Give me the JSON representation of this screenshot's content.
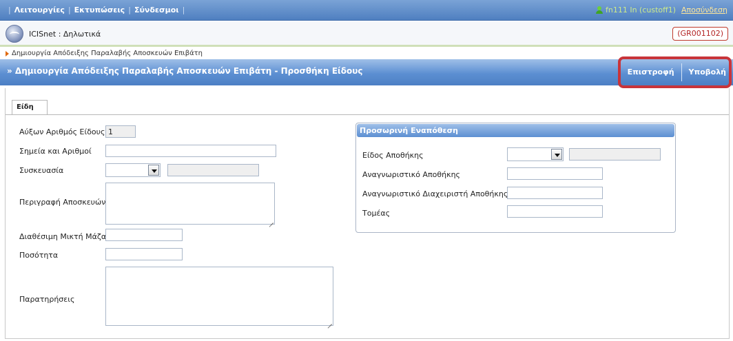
{
  "menu": {
    "items": [
      "Λειτουργίες",
      "Εκτυπώσεις",
      "Σύνδεσμοι"
    ],
    "user_text": "fn111 In (custoff1)",
    "logout_label": "Αποσύνδεση"
  },
  "app": {
    "title": "ICISnet : Δηλωτικά",
    "customs_code": "(GR001102)"
  },
  "breadcrumb": {
    "text": "Δημιουργία Απόδειξης Παραλαβής Αποσκευών Επιβάτη"
  },
  "page": {
    "title": "» Δημιουργία Απόδειξης Παραλαβής Αποσκευών Επιβάτη - Προσθήκη Είδους",
    "actions": {
      "back_label": "Επιστροφή",
      "submit_label": "Υποβολή"
    }
  },
  "tabs": {
    "items_label": "Είδη"
  },
  "form": {
    "item_number": {
      "label": "Αύξων Αριθμός Είδους",
      "value": "1"
    },
    "marks_numbers": {
      "label": "Σημεία και Αριθμοί",
      "value": ""
    },
    "packaging": {
      "label": "Συσκευασία",
      "selected": "",
      "description": ""
    },
    "baggage_description": {
      "label": "Περιγραφή Αποσκευών",
      "value": ""
    },
    "gross_mass": {
      "label": "Διαθέσιμη Μικτή Μάζα",
      "value": ""
    },
    "quantity": {
      "label": "Ποσότητα",
      "value": ""
    },
    "remarks": {
      "label": "Παρατηρήσεις",
      "value": ""
    }
  },
  "temporary_storage": {
    "title": "Προσωρινή Εναπόθεση",
    "storage_type": {
      "label": "Είδος Αποθήκης",
      "selected": "",
      "description": ""
    },
    "storage_id": {
      "label": "Αναγνωριστικό Αποθήκης",
      "value": ""
    },
    "storage_manager_id": {
      "label": "Αναγνωριστικό Διαχειριστή Αποθήκης",
      "value": ""
    },
    "sector": {
      "label": "Τομέας",
      "value": ""
    }
  },
  "colors": {
    "header_blue": "#5c8fd2",
    "highlight_red": "#c8343a",
    "customs_code_red": "#b22222"
  }
}
